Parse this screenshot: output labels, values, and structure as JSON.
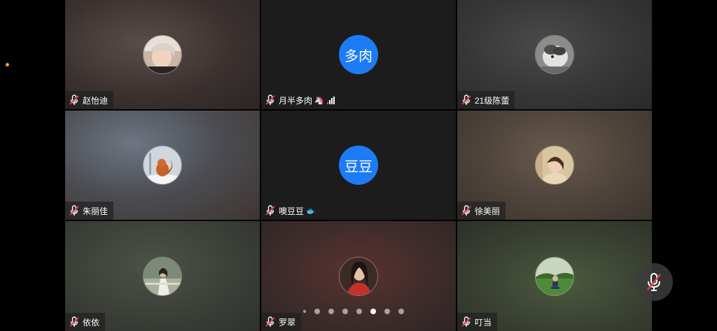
{
  "participants": [
    {
      "name": "赵怡迪",
      "avatar": "photo",
      "avatar_desc": "photo-avatar"
    },
    {
      "name": "月半多肉",
      "avatar": "text",
      "avatar_text": "多肉",
      "extra_icon": "unicorn-icon",
      "extra_glyph": "🦄",
      "signal": true
    },
    {
      "name": "21级陈蕾",
      "avatar": "photo"
    },
    {
      "name": "朱丽佳",
      "avatar": "photo"
    },
    {
      "name": "噢豆豆",
      "avatar": "text",
      "avatar_text": "豆豆",
      "extra_icon": "fish-icon",
      "extra_glyph": "🐟"
    },
    {
      "name": "徐美丽",
      "avatar": "photo"
    },
    {
      "name": "依依",
      "avatar": "photo"
    },
    {
      "name": "罗翠",
      "avatar": "photo"
    },
    {
      "name": "叮当",
      "avatar": "photo"
    }
  ],
  "pager": {
    "total": 8,
    "active_index": 6
  },
  "colors": {
    "accent_avatar": "#1d7cf5",
    "mic_muted_red": "#e5414b",
    "status_dot": "#f5a12a"
  },
  "icons": {
    "mic": "mic-muted-icon",
    "mute_button": "mute-microphone-icon"
  }
}
